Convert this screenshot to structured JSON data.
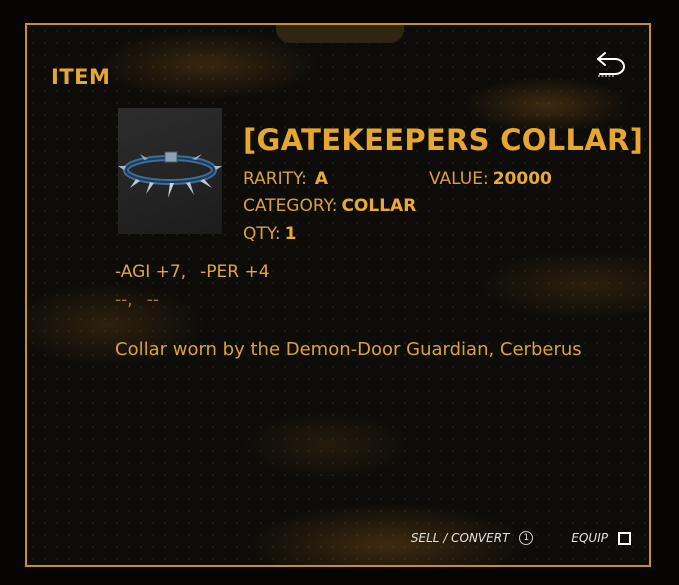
{
  "panel": {
    "section_title": "ITEM",
    "back_icon": "undo-arrow-icon"
  },
  "item": {
    "name": "[GATEKEEPERS COLLAR]",
    "image_icon": "spiked-collar-icon",
    "rarity_label": "RARITY:",
    "rarity_value": "A",
    "value_label": "VALUE:",
    "value_value": "20000",
    "category_label": "CATEGORY:",
    "category_value": "COLLAR",
    "qty_label": "QTY:",
    "qty_value": "1",
    "bonuses": [
      "-AGI +7,",
      "-PER +4"
    ],
    "empty_bonuses": [
      "--,",
      "--"
    ],
    "description": "Collar worn by the Demon-Door Guardian, Cerberus"
  },
  "actions": {
    "sell_label": "SELL / CONVERT",
    "sell_key": "①",
    "equip_label": "EQUIP"
  },
  "colors": {
    "accent": "#e6a731",
    "border": "#c98f2a",
    "background": "#0e0c09"
  }
}
